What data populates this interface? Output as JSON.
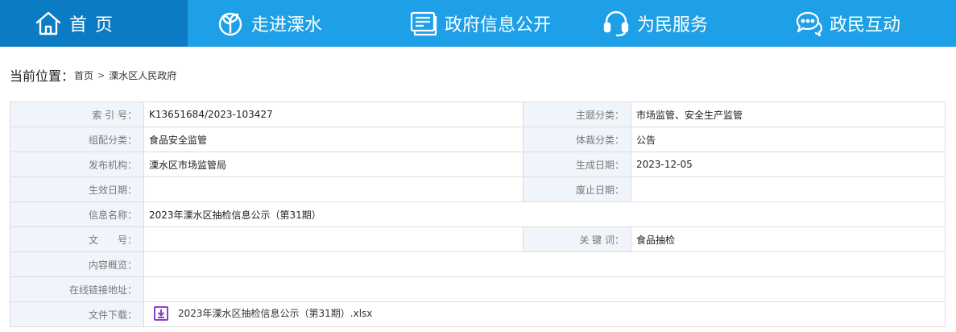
{
  "nav": {
    "items": [
      {
        "label": "首页",
        "icon": "home-icon"
      },
      {
        "label": "走进溧水",
        "icon": "sprout-icon"
      },
      {
        "label": "政府信息公开",
        "icon": "document-icon"
      },
      {
        "label": "为民服务",
        "icon": "headset-icon"
      },
      {
        "label": "政民互动",
        "icon": "chat-icon"
      }
    ],
    "bg_color": "#1ea0e8",
    "active_color": "#0b7cc4"
  },
  "breadcrumb": {
    "label": "当前位置：",
    "items": [
      "首页",
      "溧水区人民政府"
    ],
    "separator": ">"
  },
  "info": {
    "index_key": "索 引 号：",
    "index_val": "K13651684/2023-103427",
    "theme_key": "主题分类：",
    "theme_val": "市场监管、安全生产监管",
    "group_key": "组配分类：",
    "group_val": "食品安全监管",
    "genre_key": "体裁分类：",
    "genre_val": "公告",
    "publisher_key": "发布机构：",
    "publisher_val": "溧水区市场监管局",
    "created_key": "生成日期：",
    "created_val": "2023-12-05",
    "effective_key": "生效日期：",
    "effective_val": "",
    "abolished_key": "废止日期：",
    "abolished_val": "",
    "name_key": "信息名称：",
    "name_val": "2023年溧水区抽检信息公示（第31期）",
    "docno_key": "文　　号：",
    "docno_val": "",
    "keywords_key": "关 键 词：",
    "keywords_val": "食品抽检",
    "summary_key": "内容概览：",
    "summary_val": "",
    "link_key": "在线链接地址：",
    "link_val": "",
    "download_key": "文件下载：",
    "download_file": "2023年溧水区抽检信息公示（第31期）.xlsx",
    "download_icon": "download-icon",
    "download_icon_color": "#8a3fd0"
  }
}
